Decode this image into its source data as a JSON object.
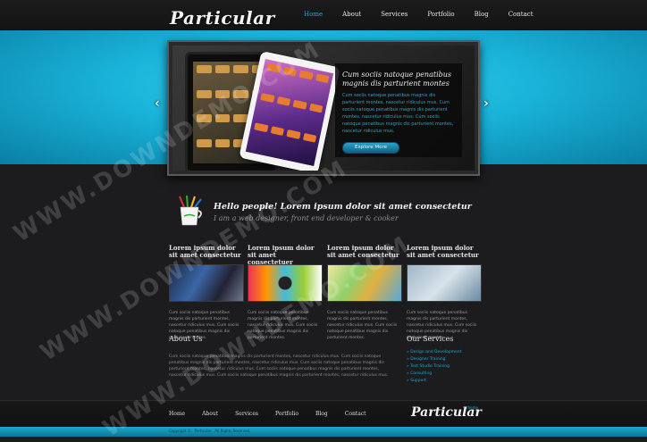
{
  "header": {
    "logo": "Particular",
    "nav": [
      "Home",
      "About",
      "Services",
      "Portfolio",
      "Blog",
      "Contact"
    ],
    "active_nav": "Home"
  },
  "slider": {
    "title": "Cum sociis natoque penatibus magnis dis parturient montes",
    "text": "Cum sociis natoque penatibus magnis dis parturient montes, nascetur ridiculus mus. Cum sociis natoque penatibus magnis dis parturient montes, nascetur ridiculus mus. Cum sociis natoque penatibus magnis dis parturient montes, nascetur ridiculus mus.",
    "button": "Explore More"
  },
  "intro": {
    "title": "Hello people! Lorem ipsum dolor sit amet consectetur",
    "subtitle": "I am a web designer, front end developer & cooker"
  },
  "columns": [
    {
      "title": "Lorem ipsum dolor sit amet consectetur",
      "text": "Cum sociis natoque penatibus magnis dis parturient montes, nascetur ridiculus mus. Cum sociis natoque penatibus magnis dis parturient montes."
    },
    {
      "title": "Lorem ipsum dolor sit amet consectetuer",
      "text": "Cum sociis natoque penatibus magnis dis parturient montes, nascetur ridiculus mus. Cum sociis natoque penatibus magnis dis parturient montes."
    },
    {
      "title": "Lorem ipsum dolor sit amet consectetur",
      "text": "Cum sociis natoque penatibus magnis dis parturient montes, nascetur ridiculus mus. Cum sociis natoque penatibus magnis dis parturient montes."
    },
    {
      "title": "Lorem ipsum dolor sit amet consectetur",
      "text": "Cum sociis natoque penatibus magnis dis parturient montes, nascetur ridiculus mus. Cum sociis natoque penatibus magnis dis parturient montes."
    }
  ],
  "about": {
    "heading": "About Us",
    "text": "Cum sociis natoque penatibus magnis dis parturient montes, nascetur ridiculus mus. Cum sociis natoque penatibus magnis dis parturient montes, nascetur ridiculus mus. Cum sociis natoque penatibus magnis dis parturient montes, nascetur ridiculus mus. Cum sociis natoque penatibus magnis dis parturient montes, nascetur ridiculus mus. Cum sociis natoque penatibus magnis dis parturient montes, nascetur ridiculus mus."
  },
  "services": {
    "heading": "Our Services",
    "items": [
      "Design and Development",
      "Designer Training",
      "Test Studio Training",
      "Consulting",
      "Support"
    ]
  },
  "footer": {
    "nav": [
      "Home",
      "About",
      "Services",
      "Portfolio",
      "Blog",
      "Contact"
    ],
    "logo": "Particular",
    "tagline": "theme",
    "copyright": "Copyright © . Particular . All Rights Reserved."
  },
  "watermark": "WWW.DOWNDEMO.COM",
  "colors": {
    "accent": "#1ea7d6",
    "band": "#1ab4da",
    "background": "#1c1c1e"
  }
}
